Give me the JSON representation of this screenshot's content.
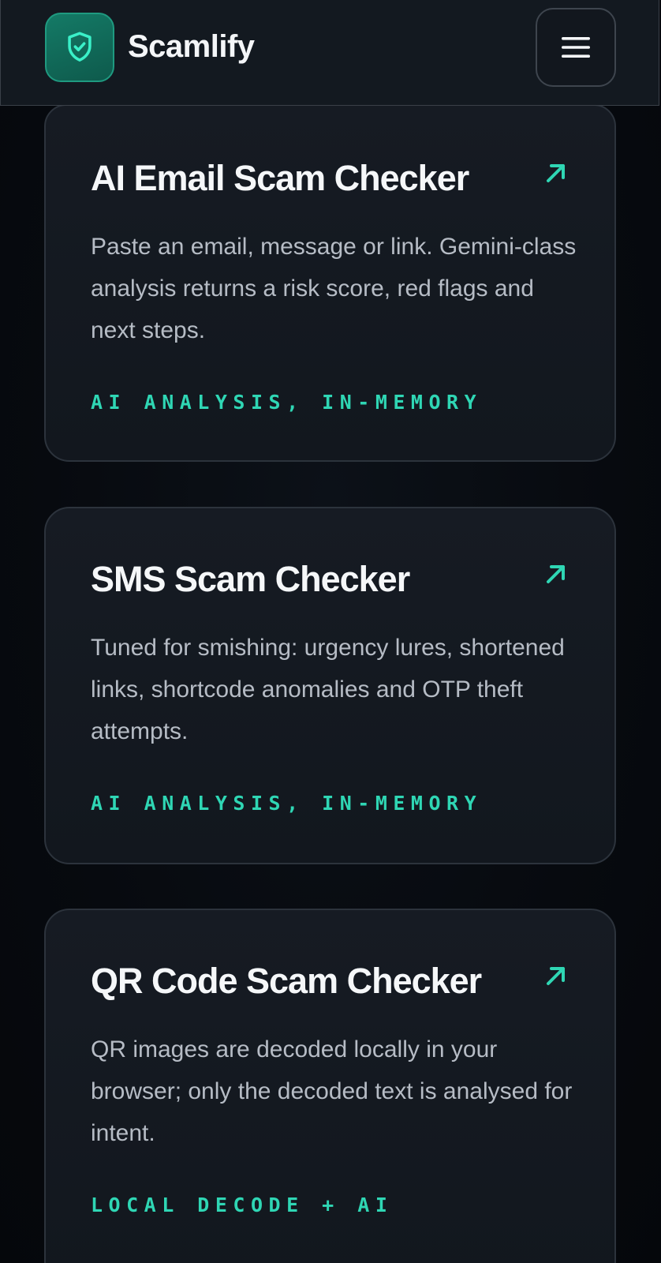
{
  "header": {
    "brand": "Scamlify",
    "logo_icon": "shield-check-icon",
    "menu_icon": "hamburger-menu-icon"
  },
  "colors": {
    "accent": "#2fd6b4",
    "logo_bg": "#147a66",
    "background": "#070a0f",
    "card_bg": "#161b23"
  },
  "cards": [
    {
      "title": "AI Email Scam Checker",
      "description": "Paste an email, message or link. Gemini-class analysis returns a risk score, red flags and next steps.",
      "tag": "AI ANALYSIS, IN-MEMORY",
      "icon": "arrow-up-right-icon"
    },
    {
      "title": "SMS Scam Checker",
      "description": "Tuned for smishing: urgency lures, shortened links, shortcode anomalies and OTP theft attempts.",
      "tag": "AI ANALYSIS, IN-MEMORY",
      "icon": "arrow-up-right-icon"
    },
    {
      "title": "QR Code Scam Checker",
      "description": "QR images are decoded locally in your browser; only the decoded text is analysed for intent.",
      "tag": "LOCAL DECODE + AI",
      "icon": "arrow-up-right-icon"
    }
  ]
}
